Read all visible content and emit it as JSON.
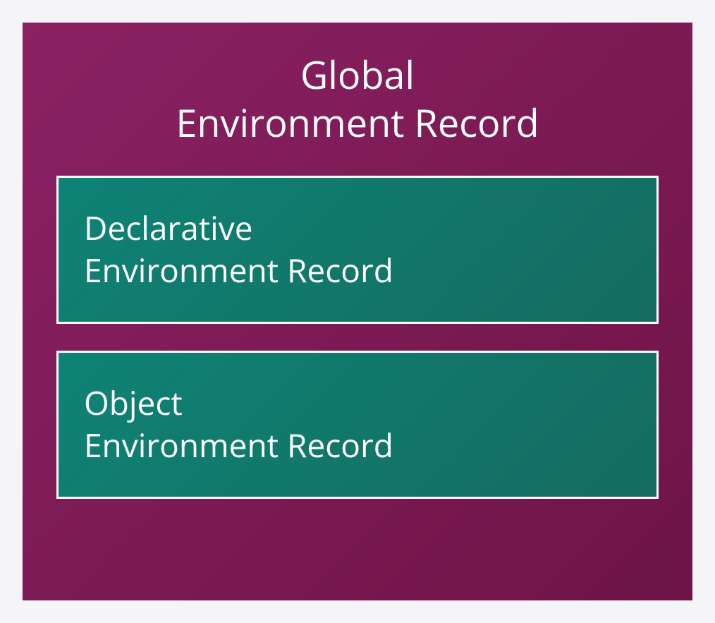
{
  "diagram": {
    "title_line1": "Global",
    "title_line2": "Environment Record",
    "boxes": [
      {
        "line1": "Declarative",
        "line2": "Environment Record"
      },
      {
        "line1": "Object",
        "line2": "Environment Record"
      }
    ],
    "colors": {
      "background": "#f5f5f7",
      "outer_gradient_start": "#8a2163",
      "outer_gradient_end": "#6e1447",
      "inner_gradient_start": "#0e8376",
      "inner_gradient_end": "#156b5f",
      "border": "#ffffff",
      "text": "#ffffff"
    }
  }
}
